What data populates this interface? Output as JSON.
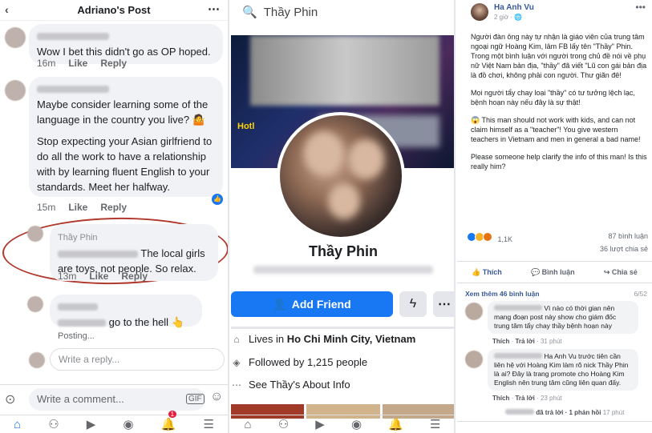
{
  "panel1": {
    "title": "Adriano's Post",
    "comments": [
      {
        "text": "Wow I bet this didn't go as OP hoped.",
        "time": "16m",
        "like": "Like",
        "reply": "Reply"
      },
      {
        "text1": "Maybe consider learning some of the language in the country you live? 🤷",
        "text2": "Stop expecting your Asian girlfriend to do all the work to have a relationship with by learning fluent English to your standards. Meet her halfway.",
        "time": "15m",
        "like": "Like",
        "reply": "Reply",
        "reaction_count": "1"
      },
      {
        "name": "Thầy Phin",
        "text": "The local girls are toys, not people. So relax.",
        "time": "13m",
        "like": "Like",
        "reply": "Reply"
      },
      {
        "text": "go to the hell 👆",
        "posting": "Posting..."
      }
    ],
    "reply_placeholder": "Write a reply...",
    "comment_placeholder": "Write a comment...",
    "gif_label": "GIF",
    "notification_count": "1"
  },
  "panel2": {
    "search_text": "Thầy Phin",
    "cover_sign": "Hotl",
    "name": "Thầy Phin",
    "add_friend": "Add Friend",
    "lives_prefix": "Lives in ",
    "lives_city": "Ho Chi Minh City, Vietnam",
    "followed": "Followed by 1,215 people",
    "about": "See Thầy's About Info"
  },
  "panel3": {
    "author": "Ha Anh Vu",
    "time": "2 giờ · 🌐",
    "para1": "Người đàn ông này tự nhận là giáo viên của trung tâm ngoại ngữ Hoàng Kim, lâm FB lấy tên \"Thầy\" Phin.",
    "para2": "Trong một bình luận với người trong chủ đề nói về phụ nữ Việt Nam bản địa, \"thầy\" đã viết \"Lũ con gái bản địa là đồ chơi, không phải con người. Thư giãn đê!",
    "para3": "Mọi người tẩy chay loại \"thầy\" có tư tưởng lệch lạc, bệnh hoạn này nếu đây là sự thật!",
    "para4": "😱 This man should not work with kids, and can not claim himself as a \"teacher\"! You give western teachers in Vietnam and men in general a bad name!",
    "para5": "Please someone help clarify the info of this man! Is this really him?",
    "reactions": "1,1K",
    "comments_count": "87 bình luận",
    "shares": "36 lượt chia sẻ",
    "like": "Thích",
    "comment": "Bình luận",
    "share": "Chia sẻ",
    "see_more": "Xem thêm 46 bình luận",
    "pager": "6/52",
    "c1_text": "Vì nào có thời gian nên mang đoạn post này show cho giám đốc trung tâm tẩy chay thầy bệnh hoạn này",
    "c1_like": "Thích",
    "c1_reply": "Trả lời",
    "c1_time": "31 phút",
    "c2_text": "Ha Anh Vu trước tiên cần liên hệ với Hoàng Kim làm rõ nick Thầy Phin là ai? Đây là trang promote cho Hoàng Kim English nên trung tâm cũng liên quan đấy.",
    "c2_like": "Thích",
    "c2_reply": "Trả lời",
    "c2_time": "23 phút",
    "c2_replies": "đã trả lời · 1 phản hồi",
    "c2_replies_time": "17 phút"
  }
}
